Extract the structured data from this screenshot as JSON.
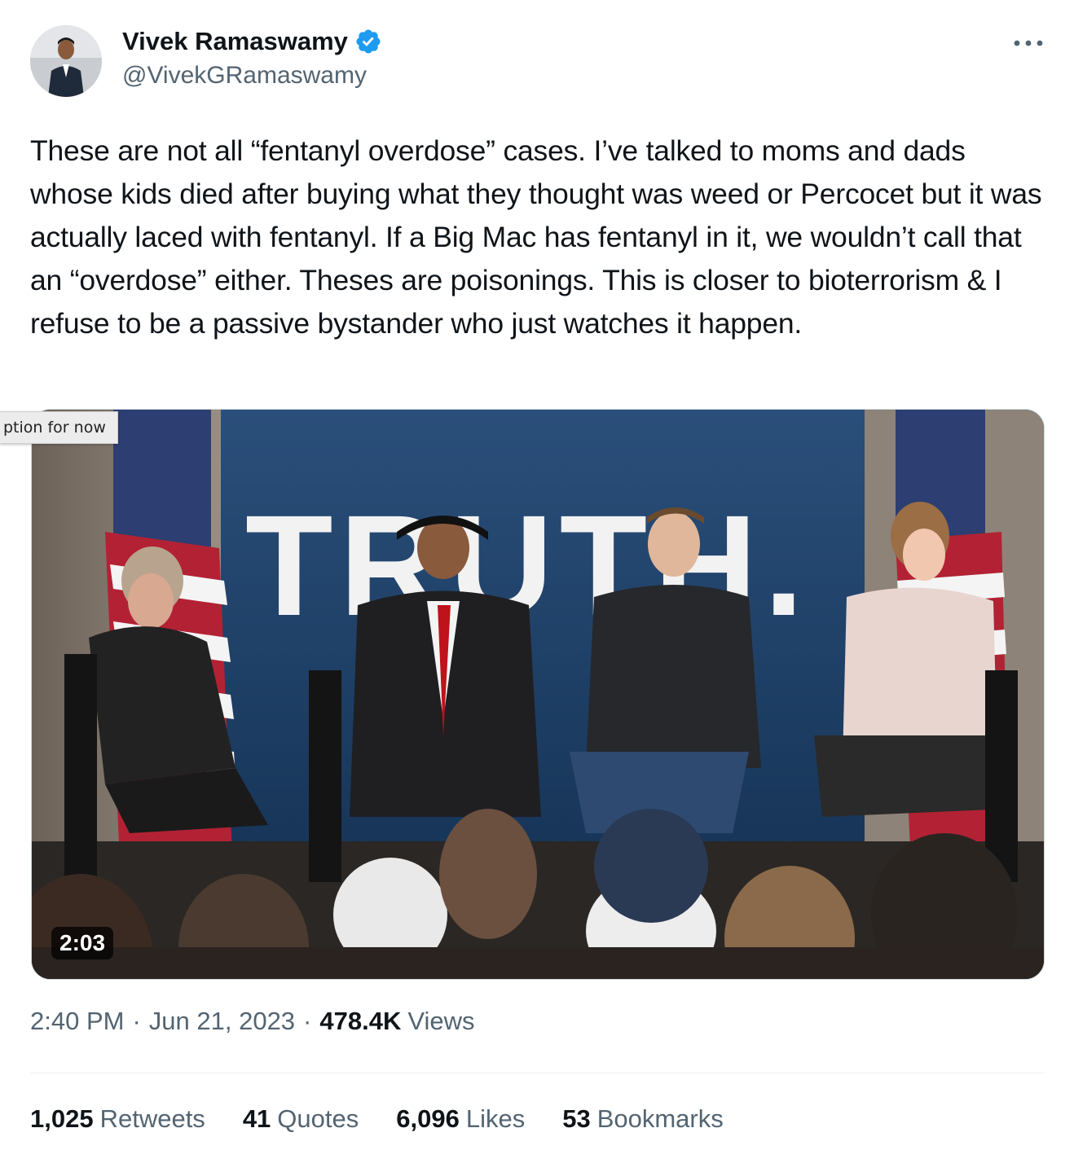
{
  "author": {
    "display_name": "Vivek Ramaswamy",
    "handle": "@VivekGRamaswamy",
    "verified": true,
    "badge_color": "#1d9bf0"
  },
  "tweet": {
    "text": "These are not all “fentanyl overdose” cases. I’ve talked to moms and dads whose kids died after buying what they thought was weed or Percocet but it was actually laced with fentanyl. If a Big Mac has fentanyl in it, we wouldn’t call that an “overdose” either. Theses are poisonings. This is closer to bioterrorism & I refuse to be a passive bystander who just watches it happen."
  },
  "media": {
    "backdrop_text": "TRUTH.",
    "duration": "2:03",
    "caption_tooltip": "ption for now"
  },
  "meta": {
    "time": "2:40 PM",
    "date": "Jun 21, 2023",
    "views_count": "478.4K",
    "views_label": "Views",
    "separator": "·"
  },
  "stats": {
    "retweets_count": "1,025",
    "retweets_label": "Retweets",
    "quotes_count": "41",
    "quotes_label": "Quotes",
    "likes_count": "6,096",
    "likes_label": "Likes",
    "bookmarks_count": "53",
    "bookmarks_label": "Bookmarks"
  },
  "colors": {
    "text_primary": "#0f1419",
    "text_secondary": "#536471",
    "divider": "#eff3f4",
    "stage_backdrop": "#1c3f66"
  },
  "icons": {
    "more": "more-horizontal-icon",
    "verified": "verified-badge-icon"
  }
}
